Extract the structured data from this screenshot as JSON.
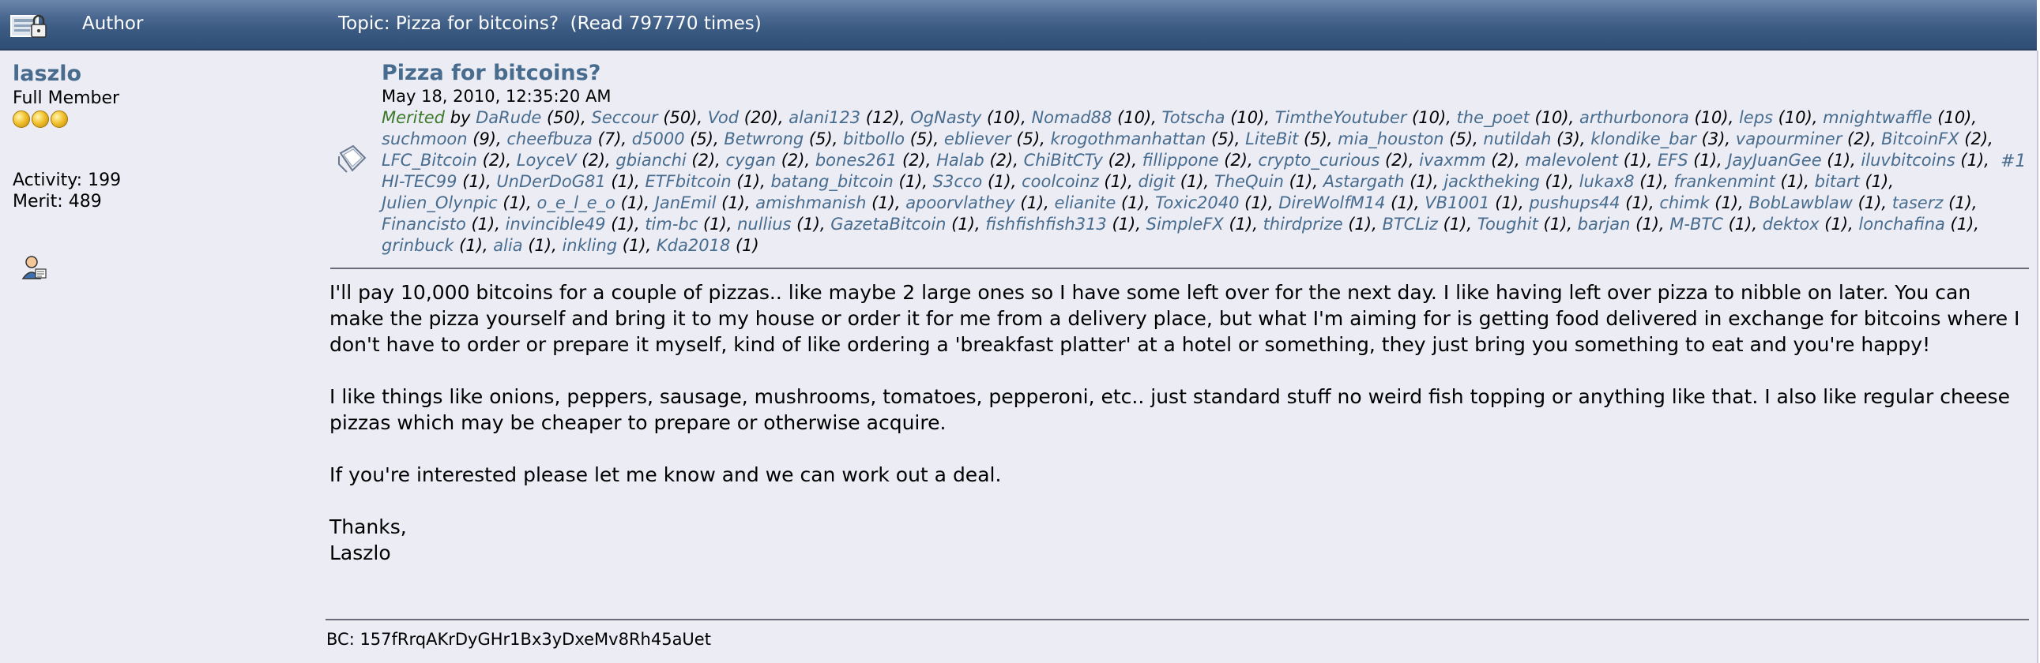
{
  "header": {
    "author_label": "Author",
    "topic_label": "Topic: Pizza for bitcoins?  (Read 797770 times)"
  },
  "poster": {
    "name": "laszlo",
    "rank": "Full Member",
    "star_count": 3,
    "activity": "Activity: 199",
    "merit": "Merit: 489"
  },
  "post": {
    "subject": "Pizza for bitcoins?",
    "date": "May 18, 2010, 12:35:20 AM",
    "number": "#1",
    "merited_label": "Merited",
    "merited_by": "by",
    "merits": [
      {
        "user": "DaRude",
        "count": "(50)"
      },
      {
        "user": "Seccour",
        "count": "(50)"
      },
      {
        "user": "Vod",
        "count": "(20)"
      },
      {
        "user": "alani123",
        "count": "(12)"
      },
      {
        "user": "OgNasty",
        "count": "(10)"
      },
      {
        "user": "Nomad88",
        "count": "(10)"
      },
      {
        "user": "Totscha",
        "count": "(10)"
      },
      {
        "user": "TimtheYoutuber",
        "count": "(10)"
      },
      {
        "user": "the_poet",
        "count": "(10)"
      },
      {
        "user": "arthurbonora",
        "count": "(10)"
      },
      {
        "user": "leps",
        "count": "(10)"
      },
      {
        "user": "mnightwaffle",
        "count": "(10)"
      },
      {
        "user": "suchmoon",
        "count": "(9)"
      },
      {
        "user": "cheefbuza",
        "count": "(7)"
      },
      {
        "user": "d5000",
        "count": "(5)"
      },
      {
        "user": "Betwrong",
        "count": "(5)"
      },
      {
        "user": "bitbollo",
        "count": "(5)"
      },
      {
        "user": "ebliever",
        "count": "(5)"
      },
      {
        "user": "krogothmanhattan",
        "count": "(5)"
      },
      {
        "user": "LiteBit",
        "count": "(5)"
      },
      {
        "user": "mia_houston",
        "count": "(5)"
      },
      {
        "user": "nutildah",
        "count": "(3)"
      },
      {
        "user": "klondike_bar",
        "count": "(3)"
      },
      {
        "user": "vapourminer",
        "count": "(2)"
      },
      {
        "user": "BitcoinFX",
        "count": "(2)"
      },
      {
        "user": "LFC_Bitcoin",
        "count": "(2)"
      },
      {
        "user": "LoyceV",
        "count": "(2)"
      },
      {
        "user": "gbianchi",
        "count": "(2)"
      },
      {
        "user": "cygan",
        "count": "(2)"
      },
      {
        "user": "bones261",
        "count": "(2)"
      },
      {
        "user": "Halab",
        "count": "(2)"
      },
      {
        "user": "ChiBitCTy",
        "count": "(2)"
      },
      {
        "user": "fillippone",
        "count": "(2)"
      },
      {
        "user": "crypto_curious",
        "count": "(2)"
      },
      {
        "user": "ivaxmm",
        "count": "(2)"
      },
      {
        "user": "malevolent",
        "count": "(1)"
      },
      {
        "user": "EFS",
        "count": "(1)"
      },
      {
        "user": "JayJuanGee",
        "count": "(1)"
      },
      {
        "user": "iluvbitcoins",
        "count": "(1)"
      },
      {
        "user": "HI-TEC99",
        "count": "(1)"
      },
      {
        "user": "UnDerDoG81",
        "count": "(1)"
      },
      {
        "user": "ETFbitcoin",
        "count": "(1)"
      },
      {
        "user": "batang_bitcoin",
        "count": "(1)"
      },
      {
        "user": "S3cco",
        "count": "(1)"
      },
      {
        "user": "coolcoinz",
        "count": "(1)"
      },
      {
        "user": "digit",
        "count": "(1)"
      },
      {
        "user": "TheQuin",
        "count": "(1)"
      },
      {
        "user": "Astargath",
        "count": "(1)"
      },
      {
        "user": "jacktheking",
        "count": "(1)"
      },
      {
        "user": "lukax8",
        "count": "(1)"
      },
      {
        "user": "frankenmint",
        "count": "(1)"
      },
      {
        "user": "bitart",
        "count": "(1)"
      },
      {
        "user": "Julien_Olynpic",
        "count": "(1)"
      },
      {
        "user": "o_e_l_e_o",
        "count": "(1)"
      },
      {
        "user": "JanEmil",
        "count": "(1)"
      },
      {
        "user": "amishmanish",
        "count": "(1)"
      },
      {
        "user": "apoorvlathey",
        "count": "(1)"
      },
      {
        "user": "elianite",
        "count": "(1)"
      },
      {
        "user": "Toxic2040",
        "count": "(1)"
      },
      {
        "user": "DireWolfM14",
        "count": "(1)"
      },
      {
        "user": "VB1001",
        "count": "(1)"
      },
      {
        "user": "pushups44",
        "count": "(1)"
      },
      {
        "user": "chimk",
        "count": "(1)"
      },
      {
        "user": "BobLawblaw",
        "count": "(1)"
      },
      {
        "user": "taserz",
        "count": "(1)"
      },
      {
        "user": "Financisto",
        "count": "(1)"
      },
      {
        "user": "invincible49",
        "count": "(1)"
      },
      {
        "user": "tim-bc",
        "count": "(1)"
      },
      {
        "user": "nullius",
        "count": "(1)"
      },
      {
        "user": "GazetaBitcoin",
        "count": "(1)"
      },
      {
        "user": "fishfishfish313",
        "count": "(1)"
      },
      {
        "user": "SimpleFX",
        "count": "(1)"
      },
      {
        "user": "thirdprize",
        "count": "(1)"
      },
      {
        "user": "BTCLiz",
        "count": "(1)"
      },
      {
        "user": "Toughit",
        "count": "(1)"
      },
      {
        "user": "barjan",
        "count": "(1)"
      },
      {
        "user": "M-BTC",
        "count": "(1)"
      },
      {
        "user": "dektox",
        "count": "(1)"
      },
      {
        "user": "lonchafina",
        "count": "(1)"
      },
      {
        "user": "grinbuck",
        "count": "(1)"
      },
      {
        "user": "alia",
        "count": "(1)"
      },
      {
        "user": "inkling",
        "count": "(1)"
      },
      {
        "user": "Kda2018",
        "count": "(1)"
      }
    ],
    "body": [
      "I'll pay 10,000 bitcoins for a couple of pizzas.. like maybe 2 large ones so I have some left over for the next day.  I like having left over pizza to nibble on later.  You can make the pizza yourself and bring it to my house or order it for me from a delivery place, but what I'm aiming for is getting food delivered in exchange for bitcoins where I don't have to order or prepare it myself, kind of like ordering a 'breakfast platter' at a hotel or something, they just bring you something to eat and you're happy!",
      "I like things like onions, peppers, sausage, mushrooms, tomatoes, pepperoni, etc.. just standard stuff no weird fish topping or anything like that.  I also like regular cheese pizzas which may be cheaper to prepare or otherwise acquire.",
      "If you're interested please let me know and we can work out a deal."
    ],
    "closing_line1": "Thanks,",
    "closing_line2": "Laszlo",
    "signature": "BC: 157fRrqAKrDyGHr1Bx3yDxeMv8Rh45aUet"
  },
  "colors": {
    "header": "#3a5a82",
    "link": "#476c8e",
    "merited": "#3a7a2a",
    "post_bg": "#ececf5"
  },
  "icons": {
    "header_icon": "locked-topic-icon",
    "post_icon": "post-icon",
    "profile_icon": "profile-icon",
    "star_icon": "star-icon"
  }
}
